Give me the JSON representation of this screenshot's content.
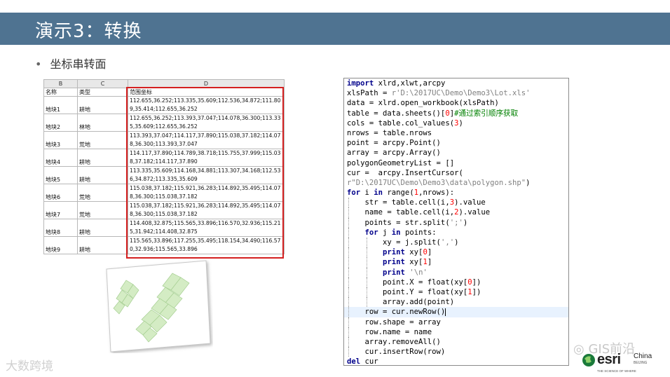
{
  "slide": {
    "title": "演示3：转换",
    "bullet": "坐标串转面"
  },
  "spreadsheet": {
    "column_letters": [
      "B",
      "C",
      "D"
    ],
    "headers": [
      "名称",
      "类型",
      "范围坐标"
    ],
    "rows": [
      {
        "name": "地块1",
        "type": "耕地",
        "coords": "112.655,36.252;113.335,35.609;112.536,34.872;111.809,35.414;112.655,36.252"
      },
      {
        "name": "地块2",
        "type": "林地",
        "coords": "112.655,36.252;113.393,37.047;114.078,36.300;113.335,35.609;112.655,36.252"
      },
      {
        "name": "地块3",
        "type": "荒地",
        "coords": "113.393,37.047;114.117,37.890;115.038,37.182;114.078,36.300;113.393,37.047"
      },
      {
        "name": "地块4",
        "type": "耕地",
        "coords": "114.117,37.890;114.789,38.718;115.755,37.999;115.038,37.182;114.117,37.890"
      },
      {
        "name": "地块5",
        "type": "耕地",
        "coords": "113.335,35.609;114.168,34.881;113.307,34.168;112.536,34.872;113.335,35.609"
      },
      {
        "name": "地块6",
        "type": "荒地",
        "coords": "115.038,37.182;115.921,36.283;114.892,35.495;114.078,36.300;115.038,37.182"
      },
      {
        "name": "地块7",
        "type": "荒地",
        "coords": "115.038,37.182;115.921,36.283;114.892,35.495;114.078,36.300;115.038,37.182"
      },
      {
        "name": "地块8",
        "type": "耕地",
        "coords": "114.408,32.875;115.565,33.896;116.570,32.936;115.215,31.942;114.408,32.875"
      },
      {
        "name": "地块9",
        "type": "耕地",
        "coords": "115.565,33.896;117.255,35.495;118.154,34.490;116.570,32.936;115.565,33.896"
      }
    ]
  },
  "code_lines": [
    [
      {
        "t": "import",
        "c": "kw"
      },
      {
        "t": " xlrd,xlwt,arcpy"
      }
    ],
    [
      {
        "t": "xlsPath = "
      },
      {
        "t": "r'D:\\2017UC\\Demo\\Demo3\\Lot.xls'",
        "c": "st"
      }
    ],
    [
      {
        "t": "data = xlrd.open_workbook(xlsPath)"
      }
    ],
    [
      {
        "t": "table = data.sheets()["
      },
      {
        "t": "0",
        "c": "nm"
      },
      {
        "t": "]"
      },
      {
        "t": "#通过索引顺序获取",
        "c": "cm"
      }
    ],
    [
      {
        "t": "cols = table.col_values("
      },
      {
        "t": "3",
        "c": "nm"
      },
      {
        "t": ")"
      }
    ],
    [
      {
        "t": "nrows = table.nrows"
      }
    ],
    [
      {
        "t": "point = arcpy.Point()"
      }
    ],
    [
      {
        "t": "array = arcpy.Array()"
      }
    ],
    [
      {
        "t": "polygonGeometryList = []"
      }
    ],
    [
      {
        "t": "cur =  arcpy.InsertCursor("
      }
    ],
    [
      {
        "t": "r\"D:\\2017UC\\Demo\\Demo3\\data\\polygon.shp\"",
        "c": "st"
      },
      {
        "t": ")"
      }
    ],
    [
      {
        "t": "for",
        "c": "kw"
      },
      {
        "t": " i "
      },
      {
        "t": "in",
        "c": "kw"
      },
      {
        "t": " range("
      },
      {
        "t": "1",
        "c": "nm"
      },
      {
        "t": ",nrows):"
      }
    ],
    [
      {
        "t": "    str = table.cell(i,"
      },
      {
        "t": "3",
        "c": "nm"
      },
      {
        "t": ").value"
      }
    ],
    [
      {
        "t": "    name = table.cell(i,"
      },
      {
        "t": "2",
        "c": "nm"
      },
      {
        "t": ").value"
      }
    ],
    [
      {
        "t": "    points = str.split("
      },
      {
        "t": "';'",
        "c": "st"
      },
      {
        "t": ")"
      }
    ],
    [
      {
        "t": "    "
      },
      {
        "t": "for",
        "c": "kw"
      },
      {
        "t": " j "
      },
      {
        "t": "in",
        "c": "kw"
      },
      {
        "t": " points:"
      }
    ],
    [
      {
        "t": "        xy = j.split("
      },
      {
        "t": "','",
        "c": "st"
      },
      {
        "t": ")"
      }
    ],
    [
      {
        "t": "        "
      },
      {
        "t": "print",
        "c": "kw"
      },
      {
        "t": " xy["
      },
      {
        "t": "0",
        "c": "nm"
      },
      {
        "t": "]"
      }
    ],
    [
      {
        "t": "        "
      },
      {
        "t": "print",
        "c": "kw"
      },
      {
        "t": " xy["
      },
      {
        "t": "1",
        "c": "nm"
      },
      {
        "t": "]"
      }
    ],
    [
      {
        "t": "        "
      },
      {
        "t": "print",
        "c": "kw"
      },
      {
        "t": " "
      },
      {
        "t": "'\\n'",
        "c": "st"
      }
    ],
    [
      {
        "t": "        point.X = float(xy["
      },
      {
        "t": "0",
        "c": "nm"
      },
      {
        "t": "])"
      }
    ],
    [
      {
        "t": "        point.Y = float(xy["
      },
      {
        "t": "1",
        "c": "nm"
      },
      {
        "t": "])"
      }
    ],
    [
      {
        "t": "        array.add(point)"
      }
    ],
    [
      {
        "t": "    row = cur.newRow()"
      }
    ],
    [
      {
        "t": "    row.shape = array"
      }
    ],
    [
      {
        "t": "    row.name = name"
      }
    ],
    [
      {
        "t": "    array.removeAll()"
      }
    ],
    [
      {
        "t": "    cur.insertRow(row)"
      }
    ],
    [
      {
        "t": "del",
        "c": "kw"
      },
      {
        "t": " cur"
      }
    ]
  ],
  "editor": {
    "highlighted_line": 24
  },
  "watermarks": {
    "left": "大数跨境",
    "right": "GIS前沿"
  },
  "logo": {
    "word": "esri",
    "region": "China",
    "city": "BEIJING",
    "tagline": "THE SCIENCE OF WHERE"
  },
  "colors": {
    "header_bg": "#4f7391",
    "sheet_highlight_border": "#d42020",
    "polygon_fill": "#d4ecc4",
    "code_keyword": "#00008b",
    "code_string": "#808080",
    "code_number": "#ff0000",
    "code_comment": "#008000"
  }
}
